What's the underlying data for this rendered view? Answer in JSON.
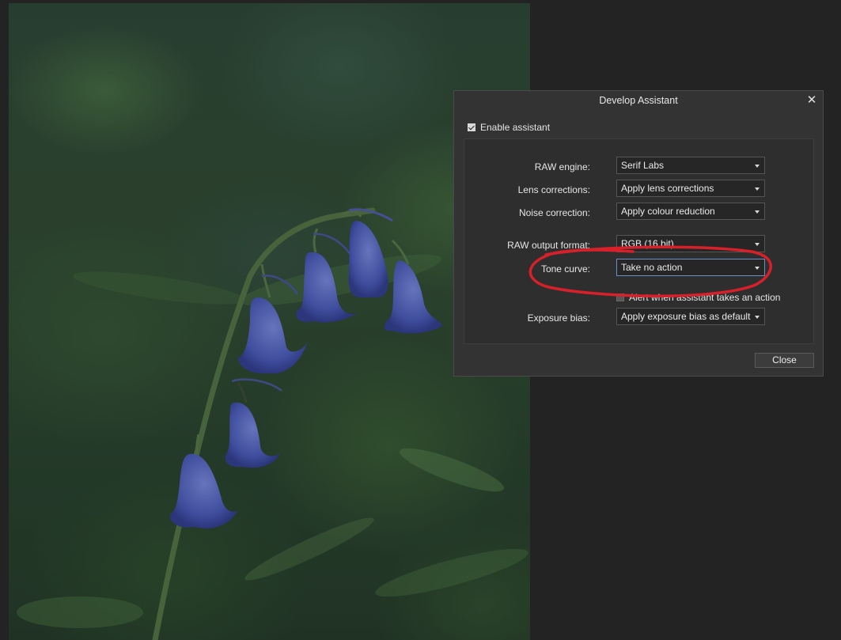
{
  "dialog": {
    "title": "Develop Assistant",
    "close_glyph": "✕",
    "enable": {
      "label": "Enable assistant",
      "checked": true
    },
    "rows": [
      {
        "label": "RAW engine:",
        "value": "Serif Labs"
      },
      {
        "label": "Lens corrections:",
        "value": "Apply lens corrections"
      },
      {
        "label": "Noise correction:",
        "value": "Apply colour reduction"
      },
      {
        "label": "RAW output format:",
        "value": "RGB (16 bit)"
      },
      {
        "label": "Tone curve:",
        "value": "Take no action"
      },
      {
        "label": "Exposure bias:",
        "value": "Apply exposure bias as default"
      }
    ],
    "alert": {
      "label": "Alert when assistant takes an action",
      "checked": false
    },
    "close_button": "Close"
  },
  "colors": {
    "background": "#232323",
    "dialog_bg": "#333333",
    "annotation_red": "#d8202a",
    "flower_blue": "#5a6fd6"
  },
  "icons": {
    "close": "close-icon",
    "dropdown": "chevron-down-icon",
    "check": "check-icon"
  }
}
